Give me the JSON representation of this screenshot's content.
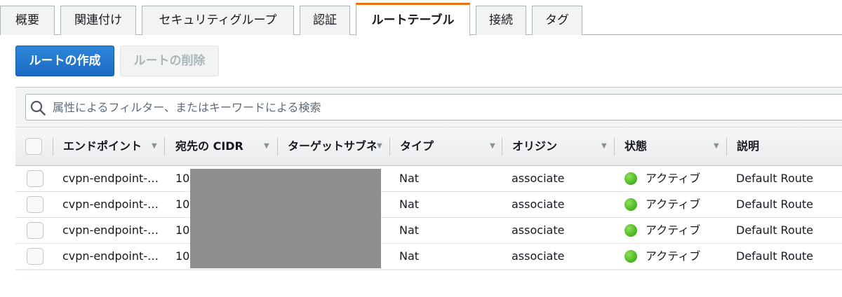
{
  "tabs": [
    {
      "label": "概要"
    },
    {
      "label": "関連付け"
    },
    {
      "label": "セキュリティグループ"
    },
    {
      "label": "認証"
    },
    {
      "label": "ルートテーブル"
    },
    {
      "label": "接続"
    },
    {
      "label": "タグ"
    }
  ],
  "active_tab": "ルートテーブル",
  "actions": {
    "create_route": "ルートの作成",
    "delete_route": "ルートの削除"
  },
  "filter": {
    "placeholder": "属性によるフィルター、またはキーワードによる検索"
  },
  "columns": {
    "endpoint": "エンドポイント",
    "dest_cidr": "宛先の CIDR",
    "target_subnet": "ターゲットサブネ",
    "type": "タイプ",
    "origin": "オリジン",
    "status": "状態",
    "description": "説明"
  },
  "rows": [
    {
      "endpoint": "cvpn-endpoint-…",
      "dest_cidr": "10.",
      "type": "Nat",
      "origin": "associate",
      "status": "アクティブ",
      "description": "Default Route"
    },
    {
      "endpoint": "cvpn-endpoint-…",
      "dest_cidr": "10.",
      "type": "Nat",
      "origin": "associate",
      "status": "アクティブ",
      "description": "Default Route"
    },
    {
      "endpoint": "cvpn-endpoint-…",
      "dest_cidr": "10.",
      "type": "Nat",
      "origin": "associate",
      "status": "アクティブ",
      "description": "Default Route"
    },
    {
      "endpoint": "cvpn-endpoint-…",
      "dest_cidr": "10.",
      "type": "Nat",
      "origin": "associate",
      "status": "アクティブ",
      "description": "Default Route"
    }
  ],
  "icons": {
    "search": "search-icon",
    "status": "status-active-icon",
    "sort": "sort-caret-icon"
  },
  "colors": {
    "primary_button": "#1b6ac4",
    "active_tab_accent": "#ec7211",
    "status_active": "#44b41c",
    "redaction": "#8f8f8f"
  }
}
